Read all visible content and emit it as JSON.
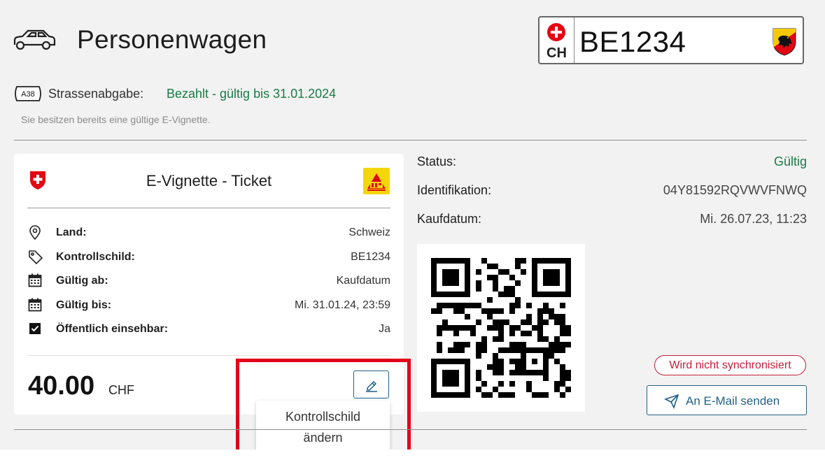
{
  "header": {
    "title": "Personenwagen",
    "plate": {
      "country": "CH",
      "number": "BE1234"
    }
  },
  "road_tax": {
    "badge": "A38",
    "label": "Strassenabgabe:",
    "status": "Bezahlt - gültig bis 31.01.2024",
    "info": "Sie besitzen bereits eine gültige E-Vignette."
  },
  "ticket": {
    "title": "E-Vignette - Ticket",
    "rows": [
      {
        "icon": "location-pin-icon",
        "label": "Land:",
        "value": "Schweiz"
      },
      {
        "icon": "tag-icon",
        "label": "Kontrollschild:",
        "value": "BE1234"
      },
      {
        "icon": "calendar-icon",
        "label": "Gültig ab:",
        "value": "Kaufdatum"
      },
      {
        "icon": "calendar-icon",
        "label": "Gültig bis:",
        "value": "Mi. 31.01.24, 23:59"
      },
      {
        "icon": "checkbox-icon",
        "label": "Öffentlich einsehbar:",
        "value": "Ja"
      }
    ],
    "price": "40.00",
    "currency": "CHF",
    "tooltip_line1": "Kontrollschild",
    "tooltip_line2": "ändern"
  },
  "details": {
    "status_label": "Status:",
    "status_value": "Gültig",
    "id_label": "Identifikation:",
    "id_value": "04Y81592RQVWVFNWQ",
    "date_label": "Kaufdatum:",
    "date_value": "Mi. 26.07.23, 11:23"
  },
  "sync_badge": "Wird nicht synchronisiert",
  "email_button": "An E-Mail senden",
  "colors": {
    "success": "#1a7a45",
    "accent": "#1f5f86",
    "danger": "#c41e3a",
    "highlight": "#e3001b"
  }
}
